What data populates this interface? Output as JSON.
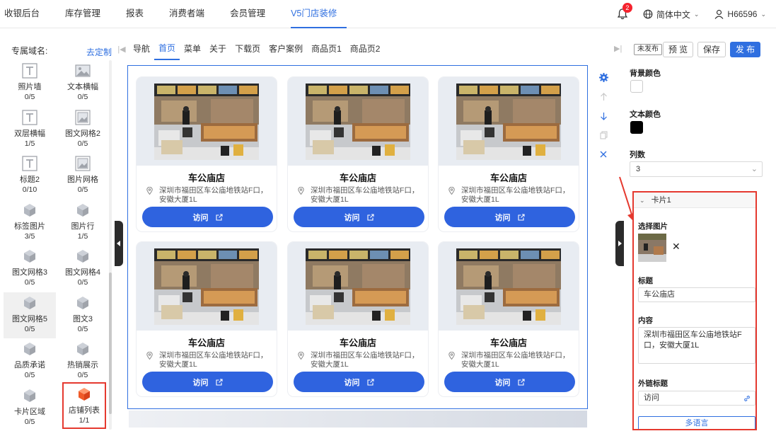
{
  "topnav": {
    "items": [
      "收银后台",
      "库存管理",
      "报表",
      "消费者端",
      "会员管理",
      "V5门店装修"
    ],
    "active_index": 5,
    "notification_count": "2",
    "language": "简体中文",
    "user": "H66596"
  },
  "leftpanel": {
    "title": "专属域名:",
    "custom_link": "去定制",
    "components": [
      {
        "name": "照片墙",
        "count": "0/5",
        "icon": "text-t-icon"
      },
      {
        "name": "文本横幅",
        "count": "0/5",
        "icon": "image-icon"
      },
      {
        "name": "双层横幅",
        "count": "1/5",
        "icon": "text-t-icon"
      },
      {
        "name": "图文网格2",
        "count": "0/5",
        "icon": "grid-image-icon"
      },
      {
        "name": "标题2",
        "count": "0/10",
        "icon": "text-t-icon"
      },
      {
        "name": "图片网格",
        "count": "0/5",
        "icon": "grid-image-icon"
      },
      {
        "name": "标签图片",
        "count": "3/5",
        "icon": "cube-icon"
      },
      {
        "name": "图片行",
        "count": "1/5",
        "icon": "cube-icon"
      },
      {
        "name": "图文网格3",
        "count": "0/5",
        "icon": "cube-icon"
      },
      {
        "name": "图文网格4",
        "count": "0/5",
        "icon": "cube-icon"
      },
      {
        "name": "图文网格5",
        "count": "0/5",
        "icon": "cube-icon"
      },
      {
        "name": "图文3",
        "count": "0/5",
        "icon": "cube-icon"
      },
      {
        "name": "品质承诺",
        "count": "0/5",
        "icon": "cube-icon"
      },
      {
        "name": "热销展示",
        "count": "0/5",
        "icon": "cube-icon"
      },
      {
        "name": "卡片区域",
        "count": "0/5",
        "icon": "cube-icon"
      },
      {
        "name": "店铺列表",
        "count": "1/1",
        "icon": "cube-icon"
      }
    ]
  },
  "pagetabs": {
    "items": [
      "导航",
      "首页",
      "菜单",
      "关于",
      "下载页",
      "客户案例",
      "商品页1",
      "商品页2"
    ],
    "active_index": 1
  },
  "toolbar": {
    "unpublished": "未发布",
    "preview": "预 览",
    "save": "保存",
    "publish": "发 布"
  },
  "cards": [
    {
      "title": "车公庙店",
      "address": "深圳市福田区车公庙地铁站F口，安徽大厦1L",
      "button": "访问"
    },
    {
      "title": "车公庙店",
      "address": "深圳市福田区车公庙地铁站F口，安徽大厦1L",
      "button": "访问"
    },
    {
      "title": "车公庙店",
      "address": "深圳市福田区车公庙地铁站F口，安徽大厦1L",
      "button": "访问"
    },
    {
      "title": "车公庙店",
      "address": "深圳市福田区车公庙地铁站F口，安徽大厦1L",
      "button": "访问"
    },
    {
      "title": "车公庙店",
      "address": "深圳市福田区车公庙地铁站F口，安徽大厦1L",
      "button": "访问"
    },
    {
      "title": "车公庙店",
      "address": "深圳市福田区车公庙地铁站F口，安徽大厦1L",
      "button": "访问"
    }
  ],
  "rightpanel": {
    "bg_color_label": "背景颜色",
    "bg_color": "#ffffff",
    "text_color_label": "文本颜色",
    "text_color": "#000000",
    "columns_label": "列数",
    "columns_value": "3",
    "card": {
      "header": "卡片1",
      "image_label": "选择图片",
      "title_label": "标题",
      "title_value": "车公庙店",
      "content_label": "内容",
      "content_value": "深圳市福田区车公庙地铁站F口，安徽大厦1L",
      "link_label": "外链标题",
      "link_value": "访问",
      "multilang": "多语言"
    }
  },
  "colors": {
    "accent": "#2f6fe0",
    "button": "#2f63df",
    "highlight": "#e5392f"
  }
}
